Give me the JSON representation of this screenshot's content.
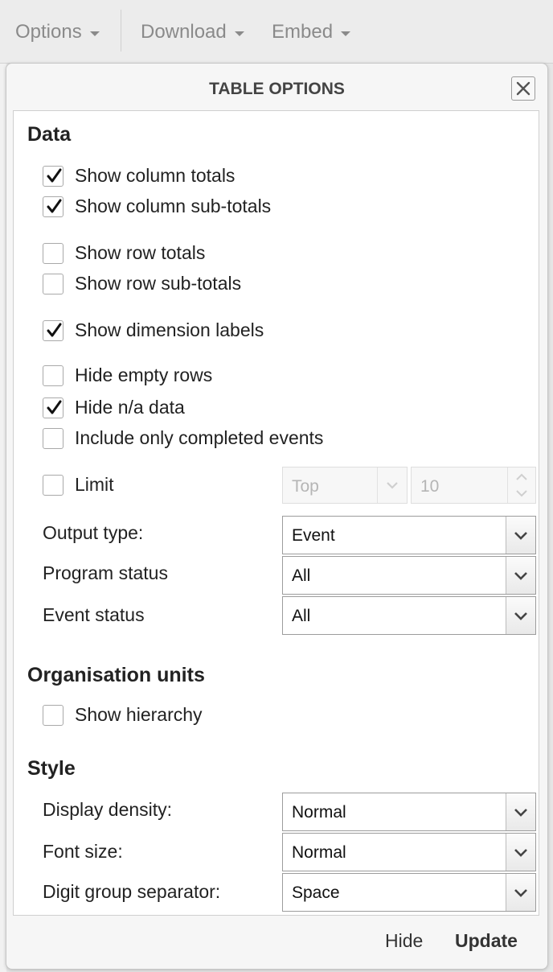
{
  "toolbar": {
    "options_label": "Options",
    "download_label": "Download",
    "embed_label": "Embed"
  },
  "dialog": {
    "title": "TABLE OPTIONS",
    "data_section": {
      "heading": "Data",
      "checkboxes": [
        {
          "label": "Show column totals",
          "checked": true
        },
        {
          "label": "Show column sub-totals",
          "checked": true
        },
        {
          "label": "Show row totals",
          "checked": false
        },
        {
          "label": "Show row sub-totals",
          "checked": false
        },
        {
          "label": "Show dimension labels",
          "checked": true
        },
        {
          "label": "Hide empty rows",
          "checked": false
        },
        {
          "label": "Hide n/a data",
          "checked": true
        },
        {
          "label": "Include only completed events",
          "checked": false
        }
      ],
      "limit": {
        "label": "Limit",
        "checked": false,
        "direction": "Top",
        "count": "10"
      },
      "output_type": {
        "label": "Output type:",
        "value": "Event"
      },
      "program_status": {
        "label": "Program status",
        "value": "All"
      },
      "event_status": {
        "label": "Event status",
        "value": "All"
      }
    },
    "org_section": {
      "heading": "Organisation units",
      "show_hierarchy": {
        "label": "Show hierarchy",
        "checked": false
      }
    },
    "style_section": {
      "heading": "Style",
      "display_density": {
        "label": "Display density:",
        "value": "Normal"
      },
      "font_size": {
        "label": "Font size:",
        "value": "Normal"
      },
      "digit_group_separator": {
        "label": "Digit group separator:",
        "value": "Space"
      }
    },
    "footer": {
      "hide_label": "Hide",
      "update_label": "Update"
    }
  },
  "colors": {
    "panel_bg": "#f6f6f6",
    "body_bg": "#ffffff",
    "toolbar_text": "#8a8a8a",
    "checkmark": "#111111"
  }
}
